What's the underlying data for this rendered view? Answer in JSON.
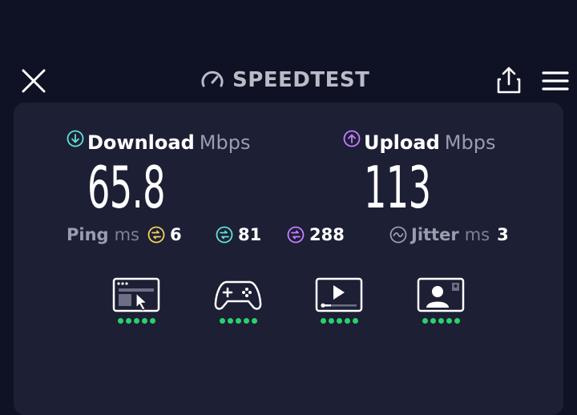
{
  "app": {
    "title": "SPEEDTEST"
  },
  "download": {
    "label": "Download",
    "unit": "Mbps",
    "value": "65.8",
    "icon": "arrow-down-circle-icon",
    "color": "#5fe3d6"
  },
  "upload": {
    "label": "Upload",
    "unit": "Mbps",
    "value": "113",
    "icon": "arrow-up-circle-icon",
    "color": "#c77dff"
  },
  "ping": {
    "label": "Ping",
    "unit": "ms",
    "idle": {
      "value": "6",
      "color": "#f2d35b"
    },
    "download": {
      "value": "81",
      "color": "#5fe3d6"
    },
    "upload": {
      "value": "288",
      "color": "#c77dff"
    }
  },
  "jitter": {
    "label": "Jitter",
    "unit": "ms",
    "value": "3"
  },
  "quality": [
    {
      "name": "web-browsing-icon",
      "rating": 5
    },
    {
      "name": "gaming-icon",
      "rating": 5
    },
    {
      "name": "video-streaming-icon",
      "rating": 5
    },
    {
      "name": "video-chat-icon",
      "rating": 5
    }
  ],
  "colors": {
    "background": "#0f1124",
    "card": "#1d1f35",
    "good": "#2bd16a",
    "muted": "#9a9cb0"
  }
}
